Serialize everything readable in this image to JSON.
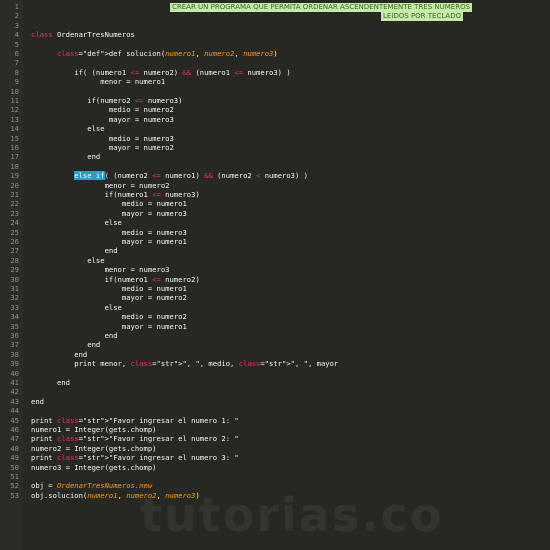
{
  "banner": {
    "line1": "CREAR UN PROGRAMA QUE PERMITA ORDENAR ASCENDENTEMENTE TRES NUMEROS",
    "line2": "LEIDOS POR TECLADO"
  },
  "watermark": "tutorias.co",
  "lines": [
    {
      "n": "1",
      "t": ""
    },
    {
      "n": "2",
      "t": ""
    },
    {
      "n": "3",
      "t": ""
    },
    {
      "n": "4",
      "t": "class OrdenarTresNumeros"
    },
    {
      "n": "5",
      "t": ""
    },
    {
      "n": "6",
      "t": "      def solucion(numero1, numero2, numero3)"
    },
    {
      "n": "7",
      "t": ""
    },
    {
      "n": "8",
      "t": "          if( (numero1 <= numero2) && (numero1 <= numero3) )"
    },
    {
      "n": "9",
      "t": "                menor = numero1"
    },
    {
      "n": "10",
      "t": ""
    },
    {
      "n": "11",
      "t": "             if(numero2 <= numero3)"
    },
    {
      "n": "12",
      "t": "                  medio = numero2"
    },
    {
      "n": "13",
      "t": "                  mayor = numero3"
    },
    {
      "n": "14",
      "t": "             else"
    },
    {
      "n": "15",
      "t": "                  medio = numero3"
    },
    {
      "n": "16",
      "t": "                  mayor = numero2"
    },
    {
      "n": "17",
      "t": "             end"
    },
    {
      "n": "18",
      "t": ""
    },
    {
      "n": "19",
      "t": "          else if( (numero2 <= numero1) && (numero2 < numero3) )"
    },
    {
      "n": "20",
      "t": "                 menor = numero2"
    },
    {
      "n": "21",
      "t": "                 if(numero1 <= numero3)"
    },
    {
      "n": "22",
      "t": "                     medio = numero1"
    },
    {
      "n": "23",
      "t": "                     mayor = numero3"
    },
    {
      "n": "24",
      "t": "                 else"
    },
    {
      "n": "25",
      "t": "                     medio = numero3"
    },
    {
      "n": "26",
      "t": "                     mayor = numero1"
    },
    {
      "n": "27",
      "t": "                 end"
    },
    {
      "n": "28",
      "t": "             else"
    },
    {
      "n": "29",
      "t": "                 menor = numero3"
    },
    {
      "n": "30",
      "t": "                 if(numero1 <= numero2)"
    },
    {
      "n": "31",
      "t": "                     medio = numero1"
    },
    {
      "n": "32",
      "t": "                     mayor = numero2"
    },
    {
      "n": "33",
      "t": "                 else"
    },
    {
      "n": "34",
      "t": "                     medio = numero2"
    },
    {
      "n": "35",
      "t": "                     mayor = numero1"
    },
    {
      "n": "36",
      "t": "                 end"
    },
    {
      "n": "37",
      "t": "             end"
    },
    {
      "n": "38",
      "t": "          end"
    },
    {
      "n": "39",
      "t": "          print menor, \", \", medio, \", \", mayor"
    },
    {
      "n": "40",
      "t": ""
    },
    {
      "n": "41",
      "t": "      end"
    },
    {
      "n": "42",
      "t": ""
    },
    {
      "n": "43",
      "t": "end"
    },
    {
      "n": "44",
      "t": ""
    },
    {
      "n": "45",
      "t": "print \"Favor ingresar el numero 1: \""
    },
    {
      "n": "46",
      "t": "numero1 = Integer(gets.chomp)"
    },
    {
      "n": "47",
      "t": "print \"Favor ingresar el numero 2: \""
    },
    {
      "n": "48",
      "t": "numero2 = Integer(gets.chomp)"
    },
    {
      "n": "49",
      "t": "print \"Favor ingresar el numero 3: \""
    },
    {
      "n": "50",
      "t": "numero3 = Integer(gets.chomp)"
    },
    {
      "n": "51",
      "t": ""
    },
    {
      "n": "52",
      "t": "obj = OrdenarTresNumeros.new"
    },
    {
      "n": "53",
      "t": "obj.solucion(numero1, numero2, numero3)"
    }
  ]
}
